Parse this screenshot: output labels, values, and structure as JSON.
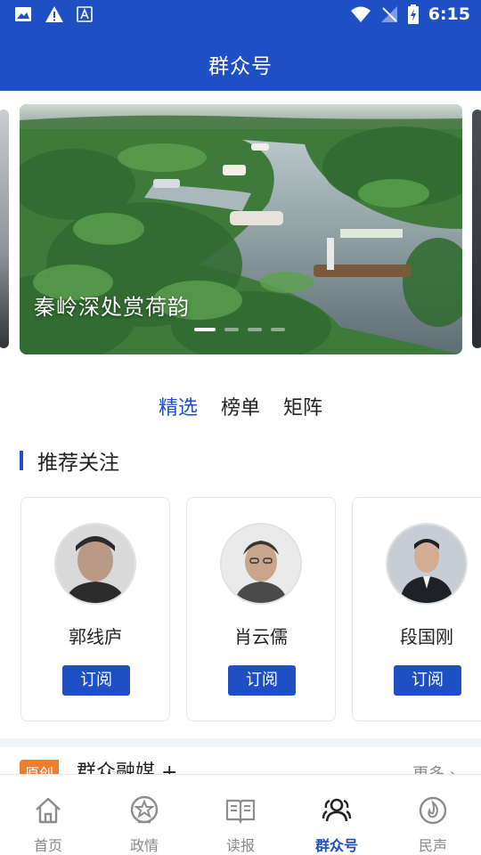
{
  "status_bar": {
    "time": "6:15"
  },
  "header": {
    "title": "群众号"
  },
  "banner": {
    "caption": "秦岭深处赏荷韵",
    "page_count": 4,
    "active_index": 0
  },
  "tabs": [
    {
      "label": "精选",
      "active": true
    },
    {
      "label": "榜单",
      "active": false
    },
    {
      "label": "矩阵",
      "active": false
    }
  ],
  "recommend": {
    "title": "推荐关注",
    "accounts": [
      {
        "name": "郭线庐",
        "button": "订阅"
      },
      {
        "name": "肖云儒",
        "button": "订阅"
      },
      {
        "name": "段国刚",
        "button": "订阅"
      }
    ]
  },
  "media": {
    "badge": "原创",
    "title": "群众融媒 +",
    "more": "更多"
  },
  "tabbar": [
    {
      "label": "首页",
      "icon": "home-icon",
      "active": false
    },
    {
      "label": "政情",
      "icon": "politics-icon",
      "active": false
    },
    {
      "label": "读报",
      "icon": "newspaper-icon",
      "active": false
    },
    {
      "label": "群众号",
      "icon": "people-icon",
      "active": true
    },
    {
      "label": "民声",
      "icon": "voice-icon",
      "active": false
    }
  ],
  "colors": {
    "brand": "#1e4fc4",
    "badge": "#f07d2d"
  }
}
